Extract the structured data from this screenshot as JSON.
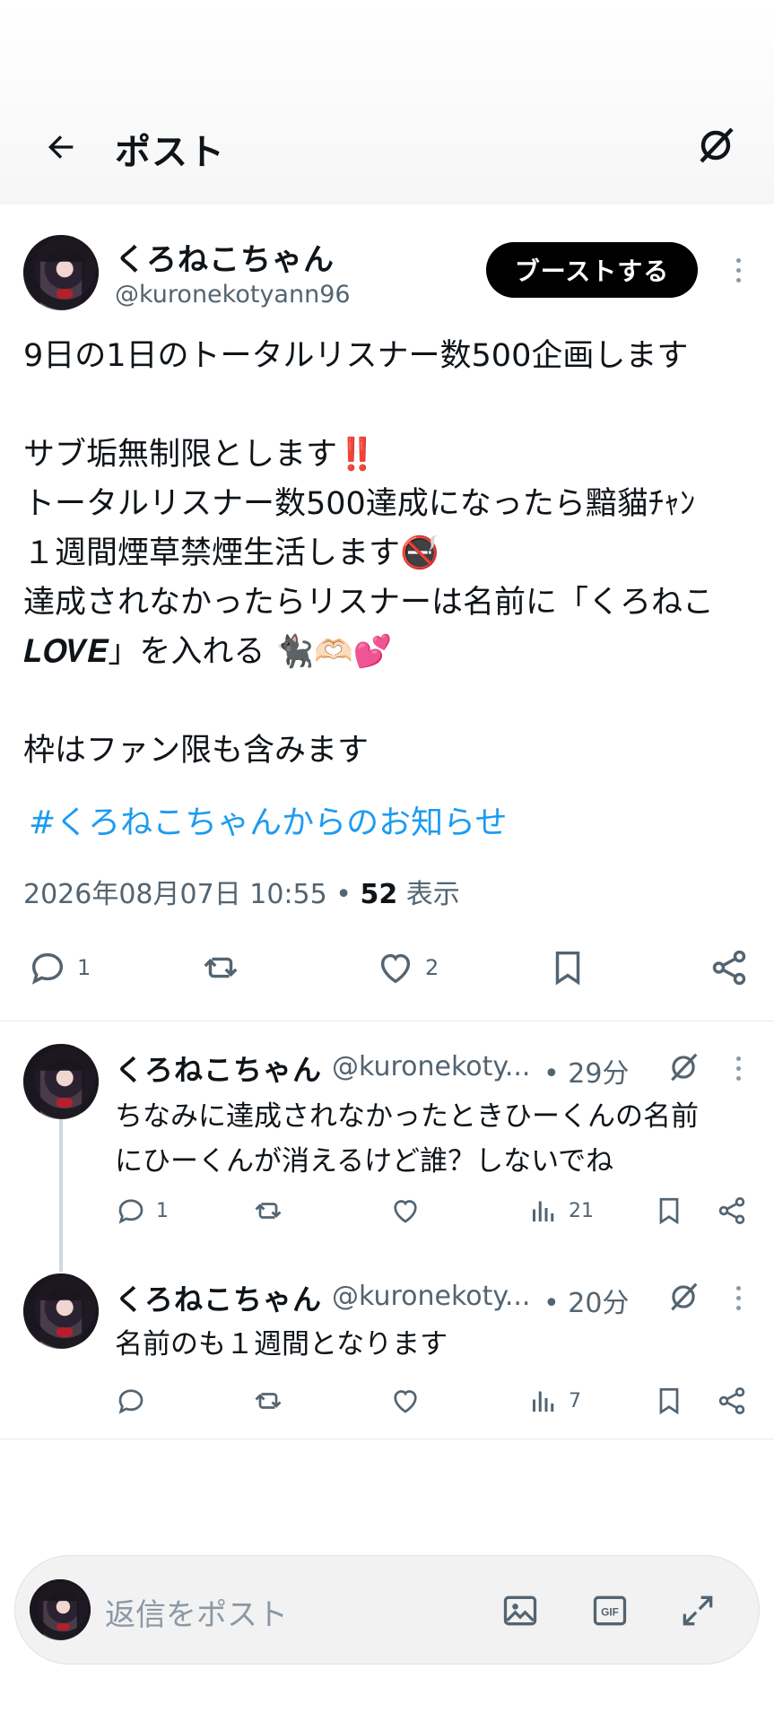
{
  "header": {
    "title": "ポスト"
  },
  "post": {
    "display_name": "くろねこちゃん",
    "handle": "@kuronekotyann96",
    "boost_label": "ブーストする",
    "body": "9日の1日のトータルリスナー数500企画します\n\nサブ垢無制限とします‼️\nトータルリスナー数500達成になったら黯貓ﾁｬﾝ\n１週間煙草禁煙生活します🚭\n達成されなかったらリスナーは名前に「くろねこ\n𝑳𝑶𝑽𝑬」を入れる 🐈‍⬛🫶🏻💕\n\n枠はファン限も含みます",
    "hashtag": "#くろねこちゃんからのお知らせ",
    "timestamp": "2026年08月07日 10:55",
    "views_count": "52",
    "views_label": "表示",
    "reply_count": "1",
    "like_count": "2"
  },
  "replies": [
    {
      "display_name": "くろねこちゃん",
      "handle": "@kuronekoty...",
      "time": "• 29分",
      "text": "ちなみに達成されなかったときひーくんの名前\nにひーくんが消えるけど誰？しないでね",
      "reply_count": "1",
      "views": "21"
    },
    {
      "display_name": "くろねこちゃん",
      "handle": "@kuronekoty...",
      "time": "• 20分",
      "text": "名前のも１週間となります",
      "reply_count": "",
      "views": "7"
    }
  ],
  "composer": {
    "placeholder": "返信をポスト"
  },
  "colors": {
    "link": "#1d9bf0",
    "muted": "#536471",
    "text": "#0f1419"
  },
  "icons": [
    "back-arrow-icon",
    "grok-icon",
    "more-icon",
    "reply-icon",
    "repost-icon",
    "like-icon",
    "bookmark-icon",
    "share-icon",
    "views-icon",
    "image-icon",
    "gif-icon",
    "expand-icon"
  ]
}
